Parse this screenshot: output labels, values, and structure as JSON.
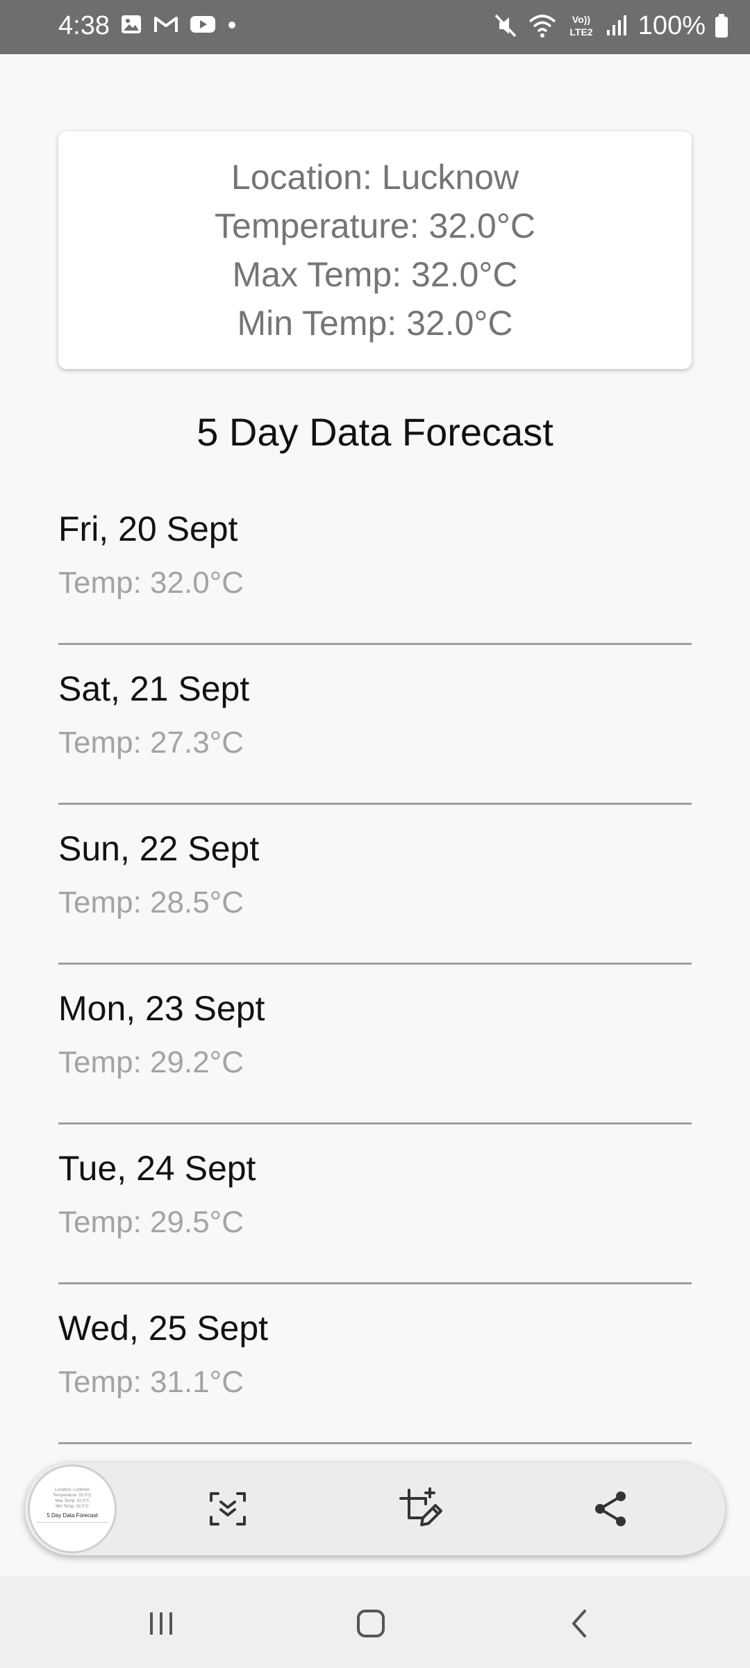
{
  "status_bar": {
    "time": "4:38",
    "battery_text": "100%",
    "left_icons": [
      "gallery-icon",
      "gmail-icon",
      "youtube-icon",
      "dot-icon"
    ],
    "right_icons": [
      "mute-icon",
      "wifi-icon",
      "volte-icon",
      "signal-icon",
      "battery-icon"
    ]
  },
  "card": {
    "location": "Location: Lucknow",
    "temperature": "Temperature: 32.0°C",
    "max_temp": "Max Temp: 32.0°C",
    "min_temp": "Min Temp: 32.0°C"
  },
  "forecast": {
    "title": "5 Day Data Forecast",
    "items": [
      {
        "date": "Fri, 20 Sept",
        "temp": "Temp: 32.0°C"
      },
      {
        "date": "Sat, 21 Sept",
        "temp": "Temp: 27.3°C"
      },
      {
        "date": "Sun, 22 Sept",
        "temp": "Temp: 28.5°C"
      },
      {
        "date": "Mon, 23 Sept",
        "temp": "Temp: 29.2°C"
      },
      {
        "date": "Tue, 24 Sept",
        "temp": "Temp: 29.5°C"
      },
      {
        "date": "Wed, 25 Sept",
        "temp": "Temp: 31.1°C"
      }
    ]
  },
  "screenshot_toolbar": {
    "icons": [
      "screenshot-thumbnail",
      "scroll-capture-icon",
      "crop-edit-icon",
      "share-icon"
    ]
  },
  "nav_bar": {
    "icons": [
      "recents-icon",
      "home-icon",
      "back-icon"
    ]
  },
  "colors": {
    "status_bar_bg": "#6e6e6e",
    "page_bg": "#f8f8f8",
    "card_text": "#757575",
    "temp_text": "#a3a3a3",
    "divider": "#9e9e9e"
  }
}
